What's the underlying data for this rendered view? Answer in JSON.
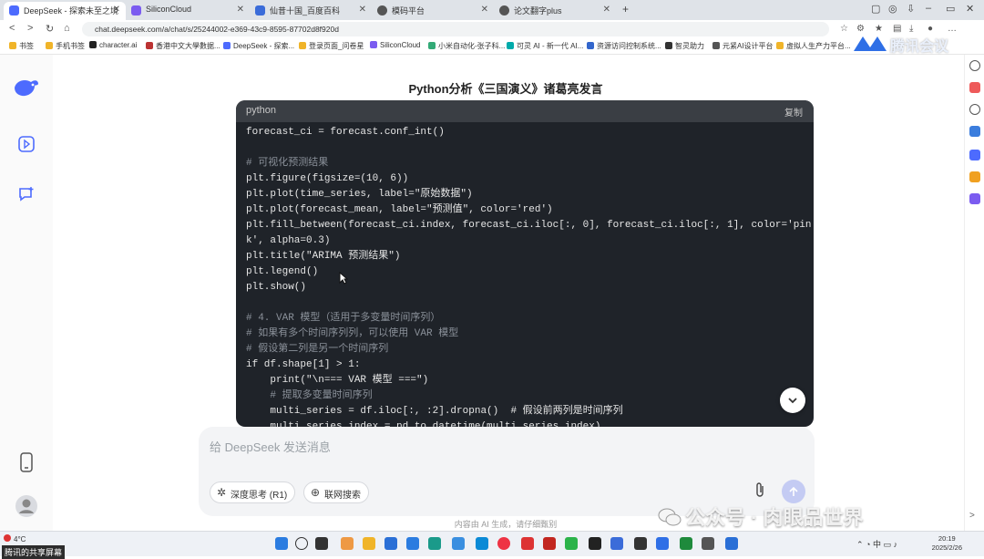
{
  "browser": {
    "tabs": [
      {
        "label": "DeepSeek - 探索未至之境",
        "color": "#4d6bfe"
      },
      {
        "label": "SiliconCloud",
        "color": "#7b5cf0"
      },
      {
        "label": "仙昔十国_百度百科",
        "color": "#3b6cd9"
      },
      {
        "label": "模码平台",
        "color": "#555555"
      },
      {
        "label": "论文翻字plus",
        "color": "#555555"
      }
    ],
    "url": "chat.deepseek.com/a/chat/s/25244002-e369-43c9-8595-87702d8f920d",
    "bookmarks": [
      "书签",
      "手机书签",
      "character.ai",
      "香港中文大學數据...",
      "DeepSeek - 探索...",
      "登录页面_问卷星",
      "SiliconCloud",
      "小米自动化-张子科...",
      "可灵 AI - 新一代 AI...",
      "资源访问控制系统...",
      "智灵助力",
      "元紧AI设计平台",
      "虚拟人生产力平台..."
    ]
  },
  "chat": {
    "title": "Python分析《三国演义》诸葛亮发言",
    "code": {
      "lang": "python",
      "copy_label": "复制",
      "lines": [
        "forecast_ci = forecast.conf_int()",
        "",
        "# 可视化预测结果",
        "plt.figure(figsize=(10, 6))",
        "plt.plot(time_series, label=\"原始数据\")",
        "plt.plot(forecast_mean, label=\"预测值\", color='red')",
        "plt.fill_between(forecast_ci.index, forecast_ci.iloc[:, 0], forecast_ci.iloc[:, 1], color='pin",
        "k', alpha=0.3)",
        "plt.title(\"ARIMA 预测结果\")",
        "plt.legend()",
        "plt.show()",
        "",
        "# 4. VAR 模型（适用于多变量时间序列）",
        "# 如果有多个时间序列列，可以使用 VAR 模型",
        "# 假设第二列是另一个时间序列",
        "if df.shape[1] > 1:",
        "    print(\"\\n=== VAR 模型 ===\")",
        "    # 提取多变量时间序列",
        "    multi_series = df.iloc[:, :2].dropna()  # 假设前两列是时间序列",
        "    multi_series.index = pd.to_datetime(multi_series.index)"
      ]
    },
    "input_placeholder": "给 DeepSeek 发送消息",
    "btn_deep_think": "深度思考 (R1)",
    "btn_web_search": "联网搜索",
    "disclaimer": "内容由 AI 生成，请仔细甄别"
  },
  "watermark": "公众号 · 肉眼品世界",
  "logo_text": "腾讯会议",
  "taskbar": {
    "weather": "4°C",
    "share_label": "腾讯的共享屏幕",
    "time": "20:19",
    "date": "2025/2/26"
  }
}
